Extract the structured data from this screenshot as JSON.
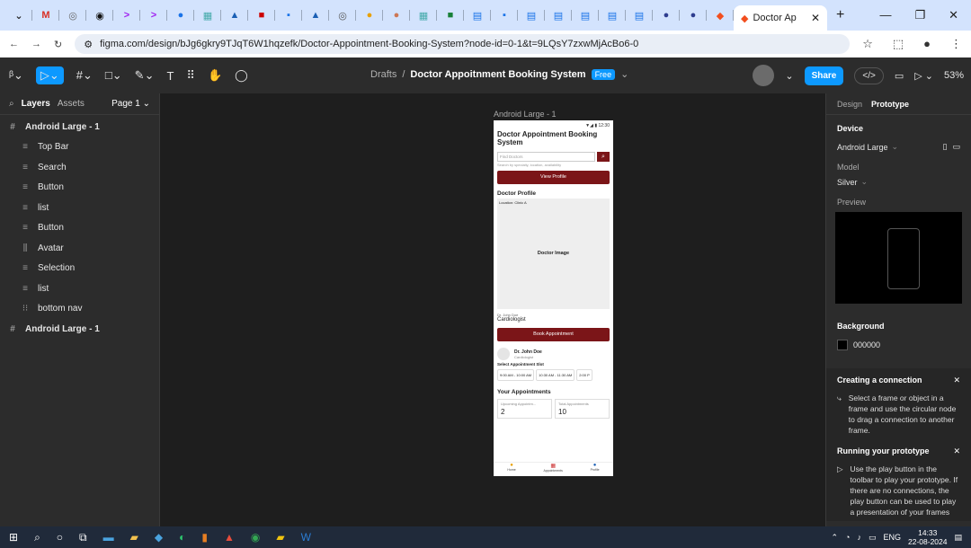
{
  "browser": {
    "tab_title": "Doctor Ap",
    "url": "figma.com/design/bJg6gkry9TJqT6W1hqzefk/Doctor-Appointment-Booking-System?node-id=0-1&t=9LQsY7zxwMjAcBo6-0"
  },
  "toolbar": {
    "breadcrumb": "Drafts",
    "file_name": "Doctor Appoitnment Booking System",
    "plan_badge": "Free",
    "share_label": "Share",
    "zoom": "53%"
  },
  "left_panel": {
    "tab_layers": "Layers",
    "tab_assets": "Assets",
    "page": "Page 1",
    "layers": [
      {
        "name": "Android Large - 1",
        "level": 0,
        "icon": "frame-icon"
      },
      {
        "name": "Top Bar",
        "level": 1,
        "icon": "layout-icon"
      },
      {
        "name": "Search",
        "level": 1,
        "icon": "layout-icon"
      },
      {
        "name": "Button",
        "level": 1,
        "icon": "layout-icon"
      },
      {
        "name": "list",
        "level": 1,
        "icon": "layout-icon"
      },
      {
        "name": "Button",
        "level": 1,
        "icon": "layout-icon"
      },
      {
        "name": "Avatar",
        "level": 1,
        "icon": "layout-icon"
      },
      {
        "name": "Selection",
        "level": 1,
        "icon": "layout-icon"
      },
      {
        "name": "list",
        "level": 1,
        "icon": "layout-icon"
      },
      {
        "name": "bottom nav",
        "level": 1,
        "icon": "component-icon"
      },
      {
        "name": "Android Large - 1",
        "level": 0,
        "icon": "frame-icon"
      }
    ]
  },
  "canvas": {
    "frame_label": "Android Large - 1",
    "phone": {
      "status": "▼◢ ▮ 12:30",
      "title": "Doctor Appointment Booking System",
      "search_placeholder": "Find Doctors",
      "search_hint": "Search by specialty, location, availability",
      "view_profile": "View Profile",
      "profile_heading": "Doctor Profile",
      "location": "Location: Clinic A",
      "image_label": "Doctor Image",
      "doctor_name_small": "Dr. John Doe",
      "specialty": "Cardiologist",
      "book_button": "Book Appointment",
      "doctor_name": "Dr. John Doe",
      "doctor_spec_small": "Cardiologist",
      "slot_title": "Select Appointment Slot",
      "slots": [
        "9:00 AM - 10:00 AM",
        "10:30 AM - 11:30 AM",
        "2:00 P"
      ],
      "appointments_heading": "Your Appointments",
      "upcoming_label": "Upcoming Appointm...",
      "upcoming_value": "2",
      "total_label": "Total Appointments",
      "total_value": "10",
      "nav": [
        "Home",
        "Appointments",
        "Profile"
      ]
    }
  },
  "right_panel": {
    "tab_design": "Design",
    "tab_prototype": "Prototype",
    "device_heading": "Device",
    "device": "Android Large",
    "model_label": "Model",
    "model": "Silver",
    "preview_label": "Preview",
    "background_heading": "Background",
    "background_value": "000000",
    "connection_title": "Creating a connection",
    "connection_text": "Select a frame or object in a frame and use the circular node to drag a connection to another frame.",
    "running_title": "Running your prototype",
    "running_text": "Use the play button in the toolbar to play your prototype. If there are no connections, the play button can be used to play a presentation of your frames"
  },
  "taskbar": {
    "lang": "ENG",
    "time": "14:33",
    "date": "22-08-2024"
  },
  "colors": {
    "accent": "#0d99ff",
    "app_primary": "#7b1518"
  }
}
